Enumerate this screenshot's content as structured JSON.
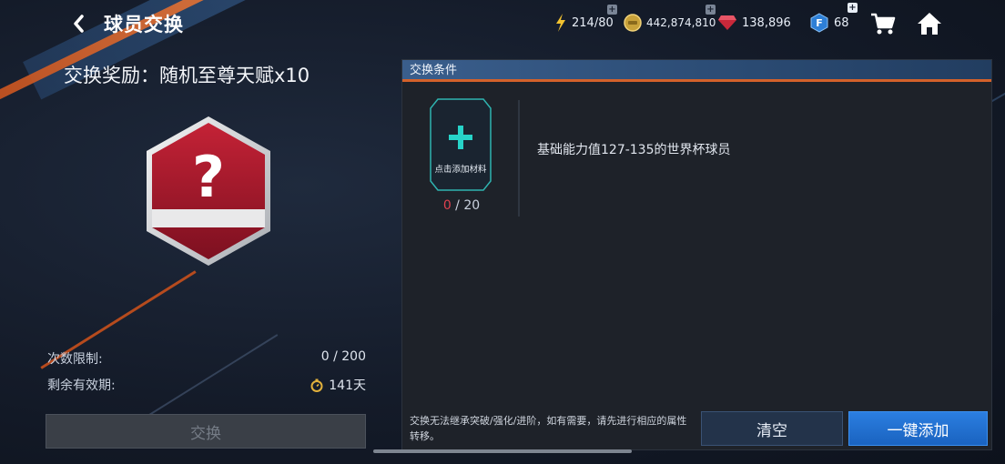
{
  "header": {
    "title": "球员交换",
    "energy": "214/80",
    "coins": "442,874,810",
    "gems": "138,896",
    "fpoints": "68"
  },
  "reward": {
    "title": "交换奖励：随机至尊天赋x10"
  },
  "stats": {
    "limit_label": "次数限制:",
    "limit_value": "0 / 200",
    "validity_label": "剩余有效期:",
    "validity_value": "141天"
  },
  "exchange_button": "交换",
  "conditions": {
    "header": "交换条件",
    "slot_label": "点击添加材料",
    "count_current": "0",
    "count_total": " / 20",
    "requirement": "基础能力值127-135的世界杯球员",
    "note": "交换无法继承突破/强化/进阶，如有需要，请先进行相应的属性转移。",
    "clear_button": "清空",
    "autoadd_button": "一键添加"
  },
  "colors": {
    "accent_blue": "#1a63c0",
    "accent_orange": "#d4612a",
    "badge_red": "#a8192e",
    "count_red": "#e0414f"
  },
  "icons": [
    "back-arrow-icon",
    "lightning-icon",
    "coin-icon",
    "gem-icon",
    "fpoint-icon",
    "cart-icon",
    "home-icon",
    "question-card-icon",
    "plus-icon",
    "stopwatch-icon"
  ]
}
